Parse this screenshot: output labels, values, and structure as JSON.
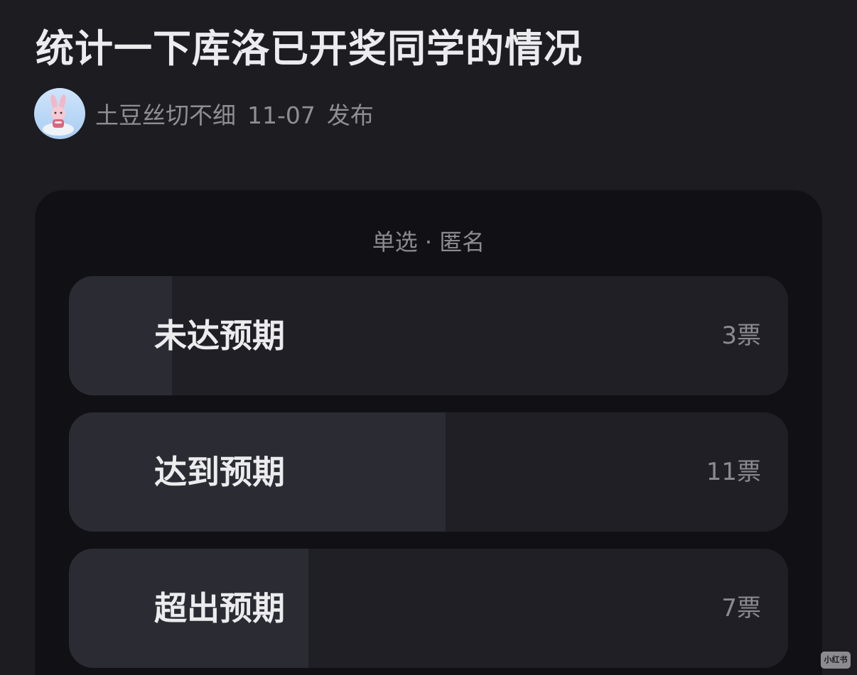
{
  "post": {
    "title": "统计一下库洛已开奖同学的情况",
    "author": "土豆丝切不细",
    "date": "11-07",
    "action": "发布"
  },
  "poll": {
    "type_label": "单选 · 匿名",
    "options": [
      {
        "label": "未达预期",
        "votes_text": "3票",
        "votes": 3
      },
      {
        "label": "达到预期",
        "votes_text": "11票",
        "votes": 11
      },
      {
        "label": "超出预期",
        "votes_text": "7票",
        "votes": 7
      }
    ]
  },
  "watermark": {
    "text": "小红书"
  },
  "colors": {
    "background": "#1c1c21",
    "card": "#111115",
    "option_bg": "#1f1f25",
    "option_fill": "#2a2b33",
    "text_primary": "#ececee",
    "text_secondary": "#8a8a90"
  },
  "icons": {
    "avatar": "pink-bunny-avatar"
  }
}
